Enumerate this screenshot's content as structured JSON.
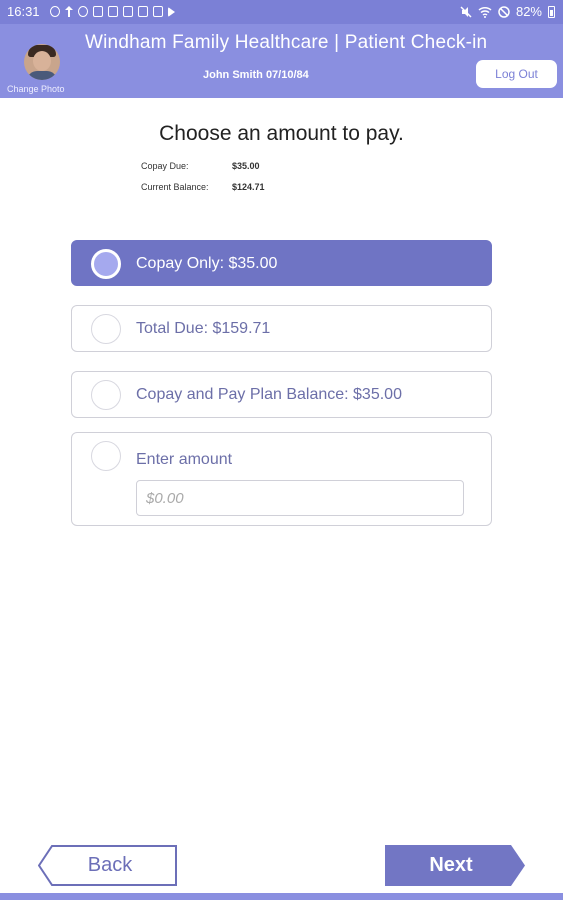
{
  "status_bar": {
    "time": "16:31",
    "battery": "82%"
  },
  "header": {
    "title": "Windham Family Healthcare | Patient Check-in",
    "patient": "John Smith 07/10/84",
    "change_photo": "Change Photo",
    "logout_label": "Log Out"
  },
  "main": {
    "title": "Choose an amount to pay.",
    "summary": [
      {
        "label": "Copay Due:",
        "value": "$35.00"
      },
      {
        "label": "Current Balance:",
        "value": "$124.71"
      }
    ],
    "options": [
      {
        "label": "Copay Only: $35.00",
        "selected": true
      },
      {
        "label": "Total Due: $159.71",
        "selected": false
      },
      {
        "label": "Copay and Pay Plan Balance: $35.00",
        "selected": false
      },
      {
        "label": "Enter amount",
        "selected": false
      }
    ],
    "amount_placeholder": "$0.00"
  },
  "footer": {
    "back_label": "Back",
    "next_label": "Next"
  },
  "colors": {
    "header": "#8a8fe0",
    "status_bar": "#7b80d6",
    "selected_option": "#6f74c4",
    "next_button": "#7276c4",
    "back_border": "#6c6fb8"
  }
}
